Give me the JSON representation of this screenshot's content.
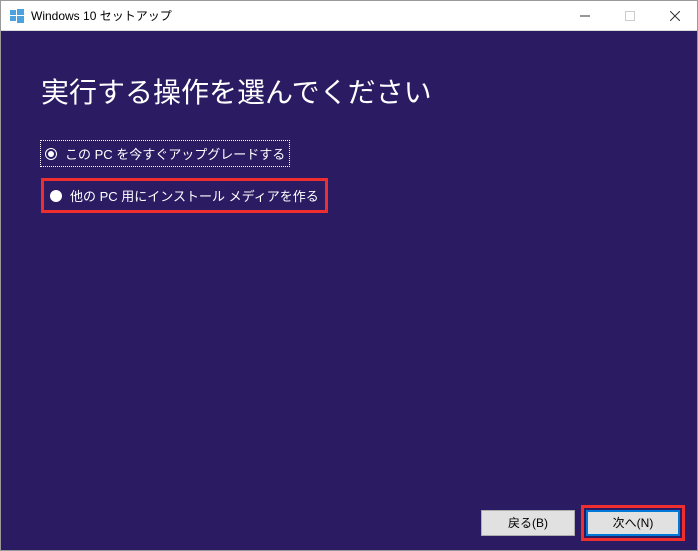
{
  "titlebar": {
    "title": "Windows 10 セットアップ"
  },
  "heading": "実行する操作を選んでください",
  "options": [
    {
      "label": "この PC を今すぐアップグレードする",
      "selected": true,
      "focused": true,
      "highlighted": false
    },
    {
      "label": "他の PC 用にインストール メディアを作る",
      "selected": false,
      "focused": false,
      "highlighted": true
    }
  ],
  "footer": {
    "back": "戻る(B)",
    "next": "次へ(N)"
  }
}
